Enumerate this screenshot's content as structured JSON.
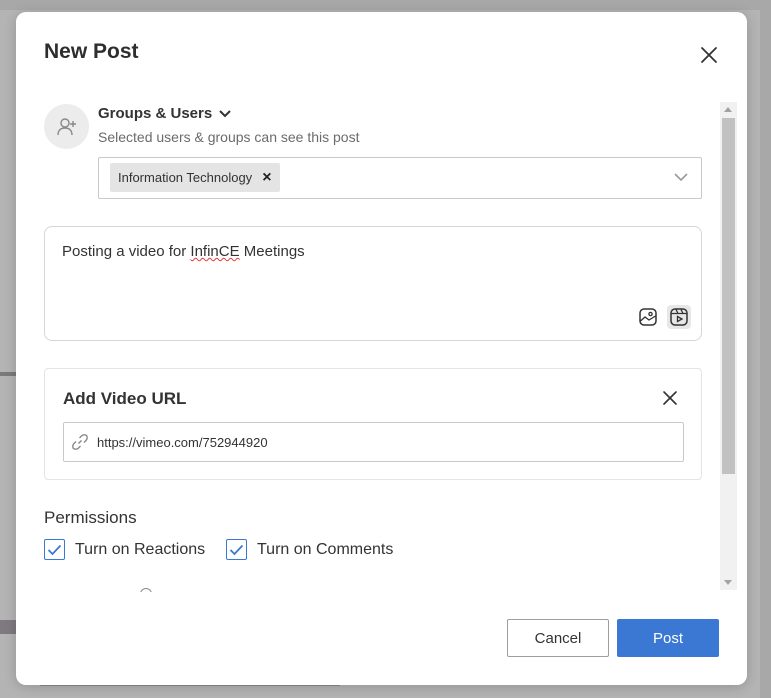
{
  "modal": {
    "title": "New Post"
  },
  "audience": {
    "label": "Groups & Users",
    "subtitle": "Selected users & groups can see this post",
    "selected": [
      {
        "label": "Information Technology"
      }
    ]
  },
  "composer": {
    "text_before": "Posting a video for ",
    "text_misspelled": "InfinCE",
    "text_after": " Meetings"
  },
  "video": {
    "title": "Add Video URL",
    "url": "https://vimeo.com/752944920"
  },
  "permissions": {
    "title": "Permissions",
    "reactions_label": "Turn on Reactions",
    "comments_label": "Turn on Comments"
  },
  "footer": {
    "cancel_label": "Cancel",
    "post_label": "Post"
  },
  "colors": {
    "primary": "#3a78d3"
  }
}
